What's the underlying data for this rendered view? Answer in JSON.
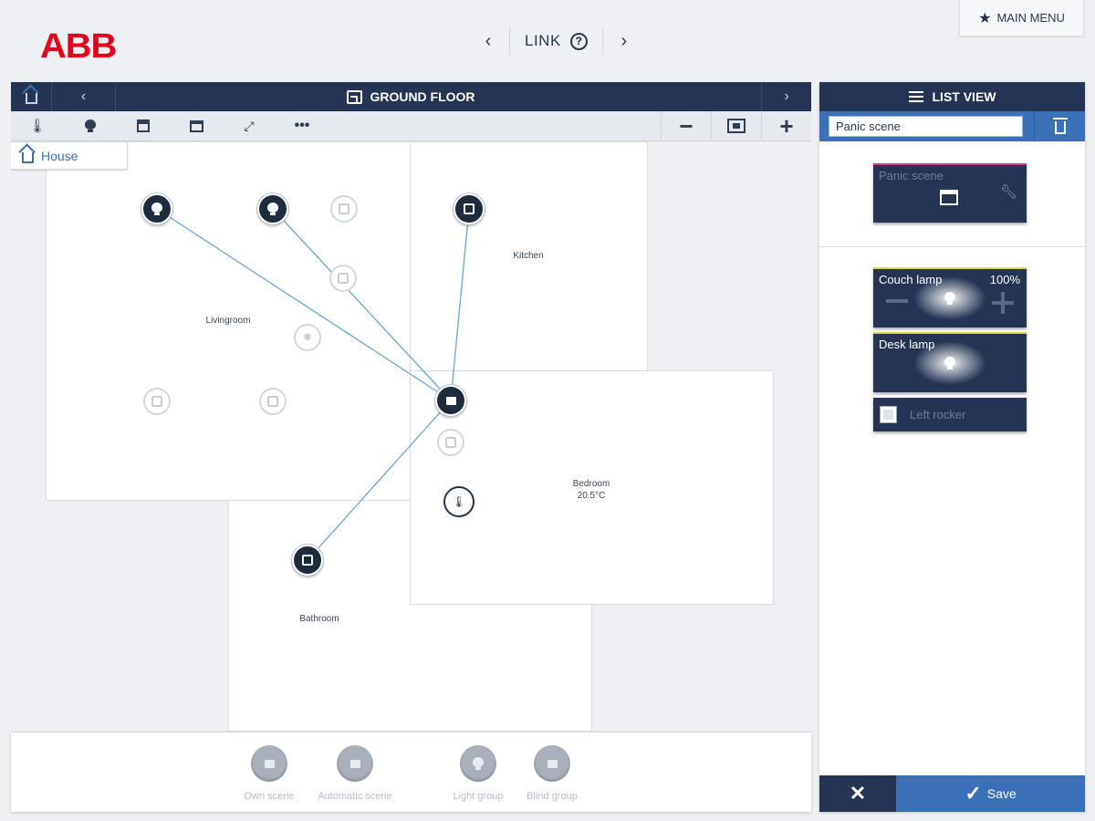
{
  "header": {
    "logo": "ABB",
    "nav_title": "LINK",
    "main_menu_label": "MAIN MENU",
    "colors": {
      "brand": "#e2001a",
      "navy": "#243452",
      "blue": "#3a70b8"
    }
  },
  "floor": {
    "title": "GROUND FLOOR",
    "breadcrumb": "House",
    "toolbar": {
      "icons": [
        "thermostat-icon",
        "light-bulb-icon",
        "blind-icon",
        "scene-icon",
        "link-icon",
        "more-icon"
      ],
      "zoom_out": "−",
      "zoom_in": "+"
    },
    "rooms": {
      "livingroom": "Livingroom",
      "kitchen": "Kitchen",
      "bedroom": "Bedroom",
      "bedroom_temp": "20.5°C",
      "bathroom": "Bathroom"
    }
  },
  "bottom_actions": [
    {
      "label": "Own scene",
      "icon": "scene-icon"
    },
    {
      "label": "Automatic scene",
      "icon": "automatic-scene-icon"
    },
    {
      "label": "Light group",
      "icon": "light-group-icon"
    },
    {
      "label": "Blind group",
      "icon": "blind-group-icon"
    }
  ],
  "list_view": {
    "title": "LIST VIEW",
    "search_value": "Panic scene",
    "scene_tile": {
      "name": "Panic scene"
    },
    "tiles": [
      {
        "name": "Couch lamp",
        "value": "100%"
      },
      {
        "name": "Desk lamp"
      },
      {
        "name": "Left rocker"
      }
    ],
    "cancel_label": "✕",
    "save_label": "Save"
  }
}
